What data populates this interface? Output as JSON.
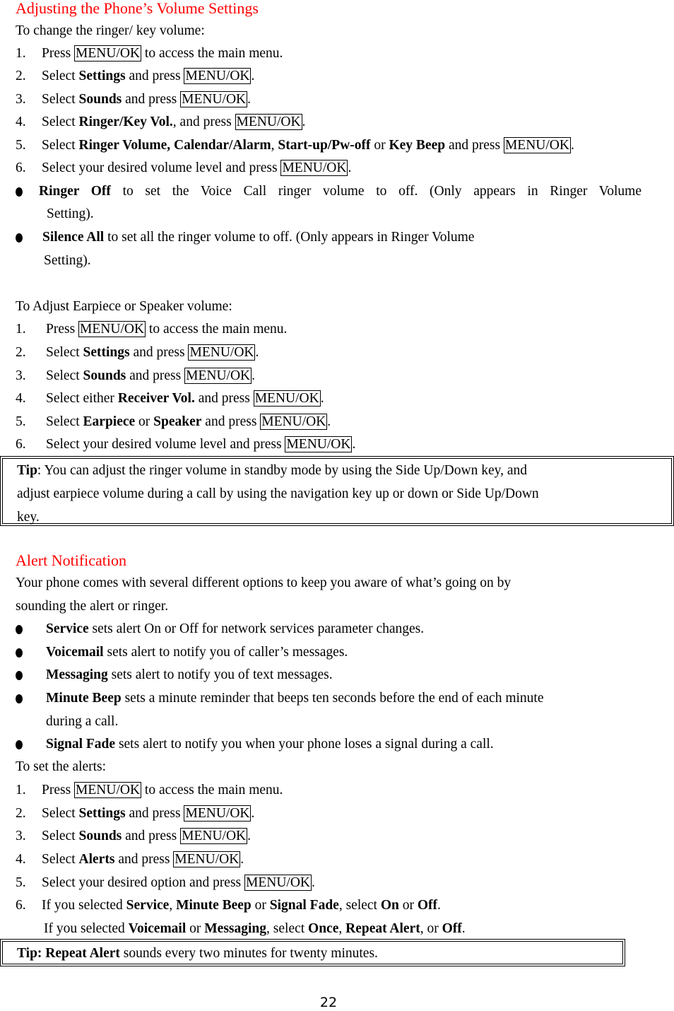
{
  "section1": {
    "title": "Adjusting the Phone’s Volume Settings",
    "intro": "To change the ringer/ key volume:",
    "key": "MENU/OK",
    "steps": [
      {
        "n": "1.",
        "pre": "Press ",
        "bold": "",
        "mid": "",
        "post": " to access the main menu."
      },
      {
        "n": "2.",
        "pre": "Select ",
        "bold": "Settings",
        "mid": " and press ",
        "post": "."
      },
      {
        "n": "3.",
        "pre": "Select ",
        "bold": "Sounds",
        "mid": " and press ",
        "post": "."
      },
      {
        "n": "4.",
        "pre": "Select ",
        "bold": "Ringer/Key Vol.",
        "mid": ", and press ",
        "post": "."
      },
      {
        "n": "5.",
        "pre": "Select ",
        "bold": "Ringer Volume, Calendar/Alarm",
        "mid": ", ",
        "bold2": "Start-up/Pw-off",
        "mid2": " or ",
        "bold3": "Key Beep",
        "mid3": " and press ",
        "post": "."
      },
      {
        "n": "6.",
        "pre": "Select your desired volume level and press ",
        "post": "."
      }
    ],
    "bullets": [
      {
        "bold": "Ringer Off",
        "text": " to set the Voice Call ringer volume to off. (Only appears in Ringer Volume",
        "cont": "Setting)."
      },
      {
        "bold": "Silence All",
        "text": " to set all the ringer volume to off. (Only appears in Ringer Volume",
        "cont": "Setting)."
      }
    ]
  },
  "section2": {
    "intro": "To Adjust Earpiece or Speaker volume:",
    "steps": [
      {
        "n": "1.",
        "pre": "Press ",
        "post": " to access the main menu."
      },
      {
        "n": "2.",
        "pre": "Select ",
        "bold": "Settings",
        "mid": " and press ",
        "post": "."
      },
      {
        "n": "3.",
        "pre": "Select ",
        "bold": "Sounds",
        "mid": " and press ",
        "post": "."
      },
      {
        "n": "4.",
        "pre": "Select either ",
        "bold": "Receiver Vol.",
        "mid": " and press ",
        "post": "."
      },
      {
        "n": "5.",
        "pre": "Select ",
        "bold": "Earpiece",
        "mid": " or ",
        "bold2": "Speaker",
        "mid2": " and press ",
        "post": "."
      },
      {
        "n": "6.",
        "pre": "Select your desired volume level and press ",
        "post": "."
      }
    ],
    "tip": {
      "label": "Tip",
      "line1": ": You can adjust the ringer volume in standby mode by using the Side Up/Down key, and",
      "line2": "adjust earpiece volume during a call by using the navigation key up or down or Side Up/Down",
      "line3": "key."
    }
  },
  "section3": {
    "title": "Alert Notification",
    "intro1": "Your phone comes with several different options to keep you aware of what’s going on by",
    "intro2": "sounding the alert or ringer.",
    "bullets": [
      {
        "bold": "Service",
        "text": " sets alert On or Off for network services parameter changes."
      },
      {
        "bold": "Voicemail",
        "text": " sets alert to notify you of caller’s messages."
      },
      {
        "bold": "Messaging",
        "text": " sets alert to notify you of text messages."
      },
      {
        "bold": "Minute Beep",
        "text": " sets a minute reminder that beeps ten seconds before the end of each minute",
        "cont": "during a call."
      },
      {
        "bold": "Signal Fade",
        "text": " sets alert to notify you when your phone loses a signal during a call."
      }
    ],
    "set_intro": "To set the alerts:",
    "steps": [
      {
        "n": "1.",
        "pre": "Press ",
        "post": " to access the main menu."
      },
      {
        "n": "2.",
        "pre": "Select ",
        "bold": "Settings",
        "mid": " and press ",
        "post": "."
      },
      {
        "n": "3.",
        "pre": "Select ",
        "bold": "Sounds",
        "mid": " and press ",
        "post": "."
      },
      {
        "n": "4.",
        "pre": "Select ",
        "bold": "Alerts",
        "mid": " and press ",
        "post": "."
      },
      {
        "n": "5.",
        "pre": "Select your desired option and press ",
        "post": "."
      }
    ],
    "step6": {
      "n": "6.",
      "a": "If you selected ",
      "b1": "Service",
      "c1": ", ",
      "b2": "Minute Beep",
      "c2": " or ",
      "b3": "Signal Fade",
      "c3": ", select ",
      "b4": "On",
      "c4": " or ",
      "b5": "Off",
      "c5": "."
    },
    "step6b": {
      "a": "If you selected ",
      "b1": "Voicemail",
      "c1": " or ",
      "b2": "Messaging",
      "c2": ", select ",
      "b3": "Once",
      "c3": ", ",
      "b4": "Repeat Alert",
      "c4": ", or ",
      "b5": "Off",
      "c5": "."
    },
    "tip": {
      "label": "Tip: Repeat Alert",
      "text": " sounds every two minutes for twenty minutes."
    }
  },
  "page_number": "22"
}
